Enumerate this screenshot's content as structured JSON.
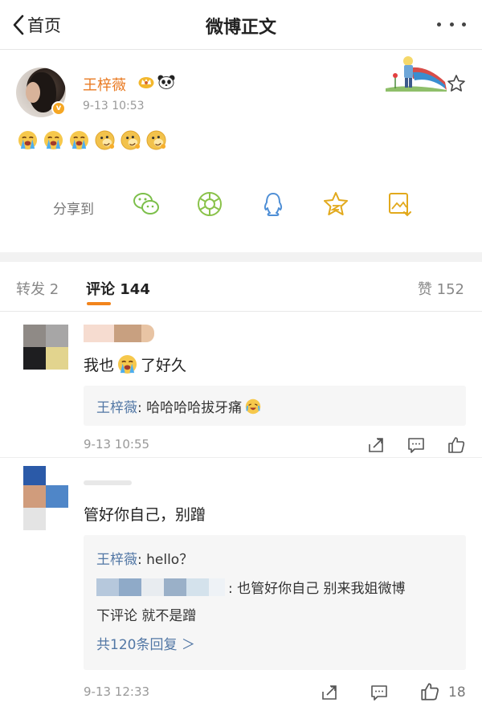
{
  "nav": {
    "back_label": "首页",
    "title": "微博正文"
  },
  "post": {
    "author": "王梓薇",
    "time": "9-13 10:53",
    "emoji_icons": [
      "crying-face-icon",
      "crying-face-icon",
      "crying-face-icon",
      "doge-laugh-icon",
      "doge-laugh-icon",
      "doge-laugh-icon"
    ]
  },
  "share": {
    "label": "分享到",
    "targets": [
      "wechat-icon",
      "moments-icon",
      "qq-icon",
      "favorite-star-icon",
      "save-image-icon"
    ]
  },
  "tabs": {
    "repost": "转发 2",
    "comments": "评论 144",
    "likes": "赞 152"
  },
  "comments": [
    {
      "text_before": "我也",
      "text_after": "了好久",
      "reply": {
        "name": "王梓薇",
        "text": ": 哈哈哈哈拔牙痛"
      },
      "time": "9-13 10:55"
    },
    {
      "text": "管好你自己，别蹭",
      "reply": {
        "name": "王梓薇",
        "text": ": hello？",
        "line2": ": 也管好你自己 别来我姐微博",
        "line3": "下评论 就不是蹭",
        "more": "共120条回复 ＞"
      },
      "time": "9-13 12:33",
      "like_count": "18"
    }
  ],
  "colors": {
    "accent": "#f2841c",
    "author": "#e97a22",
    "link": "#5277a5",
    "icon_green": "#8ac24a",
    "icon_blue": "#4f8fd6",
    "icon_gold": "#e2a91c"
  }
}
